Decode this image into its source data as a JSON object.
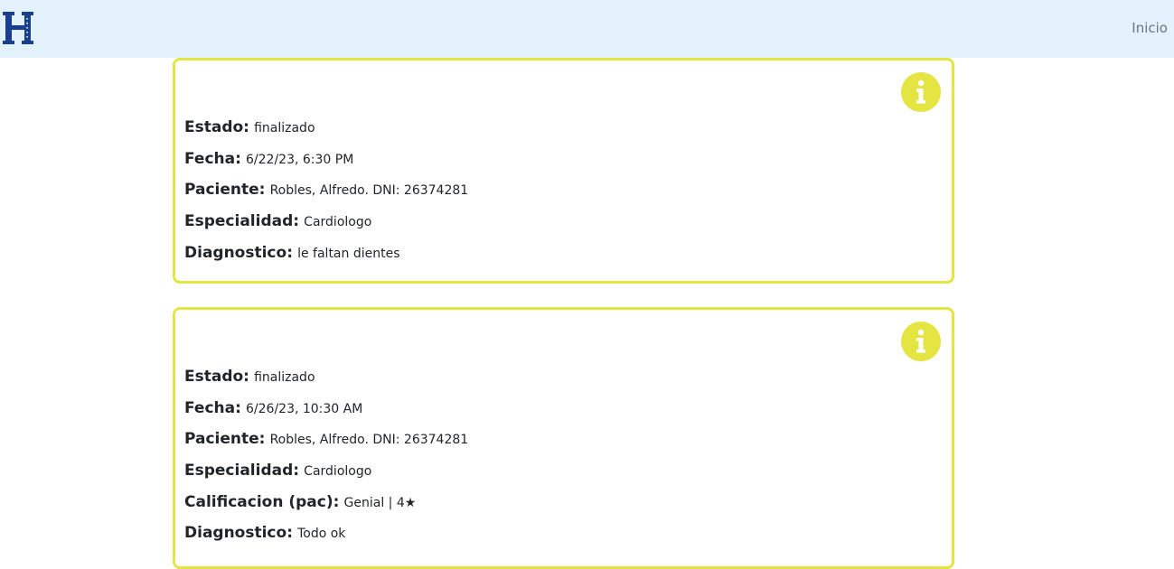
{
  "nav": {
    "logo_icon": "hospital-h-logo",
    "inicio_label": "Inicio"
  },
  "colors": {
    "navbar_bg": "#e3f2fd",
    "card_border": "#e4e443",
    "logo": "#1a3f8f"
  },
  "turnos": [
    {
      "info_icon": "info-icon",
      "rows": [
        {
          "label": "Estado:",
          "value": "finalizado"
        },
        {
          "label": "Fecha:",
          "value": "6/22/23, 6:30 PM"
        },
        {
          "label": "Paciente:",
          "value": "Robles, Alfredo. DNI: 26374281"
        },
        {
          "label": "Especialidad:",
          "value": "Cardiologo"
        },
        {
          "label": "Diagnostico:",
          "value": "le faltan dientes"
        }
      ]
    },
    {
      "info_icon": "info-icon",
      "rows": [
        {
          "label": "Estado:",
          "value": "finalizado"
        },
        {
          "label": "Fecha:",
          "value": "6/26/23, 10:30 AM"
        },
        {
          "label": "Paciente:",
          "value": "Robles, Alfredo. DNI: 26374281"
        },
        {
          "label": "Especialidad:",
          "value": "Cardiologo"
        },
        {
          "label": "Calificacion (pac):",
          "value": "Genial | 4★"
        },
        {
          "label": "Diagnostico:",
          "value": "Todo ok"
        }
      ]
    }
  ]
}
